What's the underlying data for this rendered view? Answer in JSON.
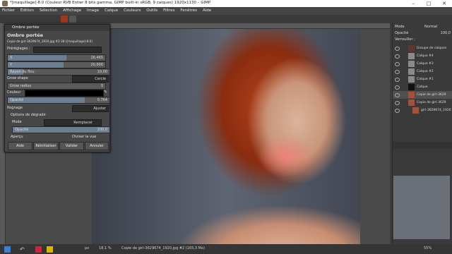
{
  "window": {
    "title": "*[maquillage]-8.0 (Couleur RVB Entier 8 bits gamma, GIMP built-in sRGB, 9 calques) 1920x1130 – GIMP"
  },
  "menu": [
    "Fichier",
    "Édition",
    "Sélection",
    "Affichage",
    "Image",
    "Calque",
    "Couleurs",
    "Outils",
    "Filtres",
    "Fenêtres",
    "Aide"
  ],
  "dialog": {
    "window_title": "Ombre portée",
    "heading": "Ombre portée",
    "subheading": "Copie de girl-3629674_1920.jpg #2-28 ([maquillage]-8.0)",
    "presets_label": "Préréglages :",
    "x_label": "X",
    "x_value": "26,465",
    "y_label": "Y",
    "y_value": "20,000",
    "blur_label": "Rayon du flou",
    "blur_value": "10,00",
    "grow_shape_label": "Grow shape",
    "grow_shape_value": "Cercle",
    "grow_radius_label": "Grow radius",
    "grow_radius_value": "0",
    "color_label": "Couleur",
    "opacity_label": "Opacité",
    "opacity_value": "0,764",
    "opacity_fraction": 0.76,
    "clipping_label": "Rognage",
    "clipping_value": "Ajuster",
    "blend_options_label": "Options de dégradé",
    "mode_label": "Mode",
    "mode_value": "Remplacer",
    "opacity2_label": "Opacité",
    "opacity2_value": "100,0",
    "preview_label": "Aperçu",
    "split_label": "Diviser la vue",
    "buttons": {
      "help": "Aide",
      "reset": "Réinitialiser",
      "ok": "Valider",
      "cancel": "Annuler"
    }
  },
  "layers": {
    "mode_label": "Mode",
    "mode_value": "Normal",
    "opacity_label": "Opacité",
    "opacity_value": "100,0",
    "lock_label": "Verrouiller :",
    "items": [
      {
        "name": "Groupe de calques"
      },
      {
        "name": "Calque #4"
      },
      {
        "name": "Calque #3"
      },
      {
        "name": "Calque #2"
      },
      {
        "name": "Calque #1"
      },
      {
        "name": "Calque"
      },
      {
        "name": "Copie de girl-3629"
      },
      {
        "name": "Copie de girl-3629"
      },
      {
        "name": "girl-3629674_1920"
      }
    ]
  },
  "status": {
    "unit": "px",
    "zoom": "18,1 %",
    "info": "Copie de girl-3629674_1920.jpg #2 (165,3 Mo)",
    "nav_zoom": "55%"
  },
  "colors": {
    "accent": "#6c7e92",
    "hair": "#b2421c"
  }
}
